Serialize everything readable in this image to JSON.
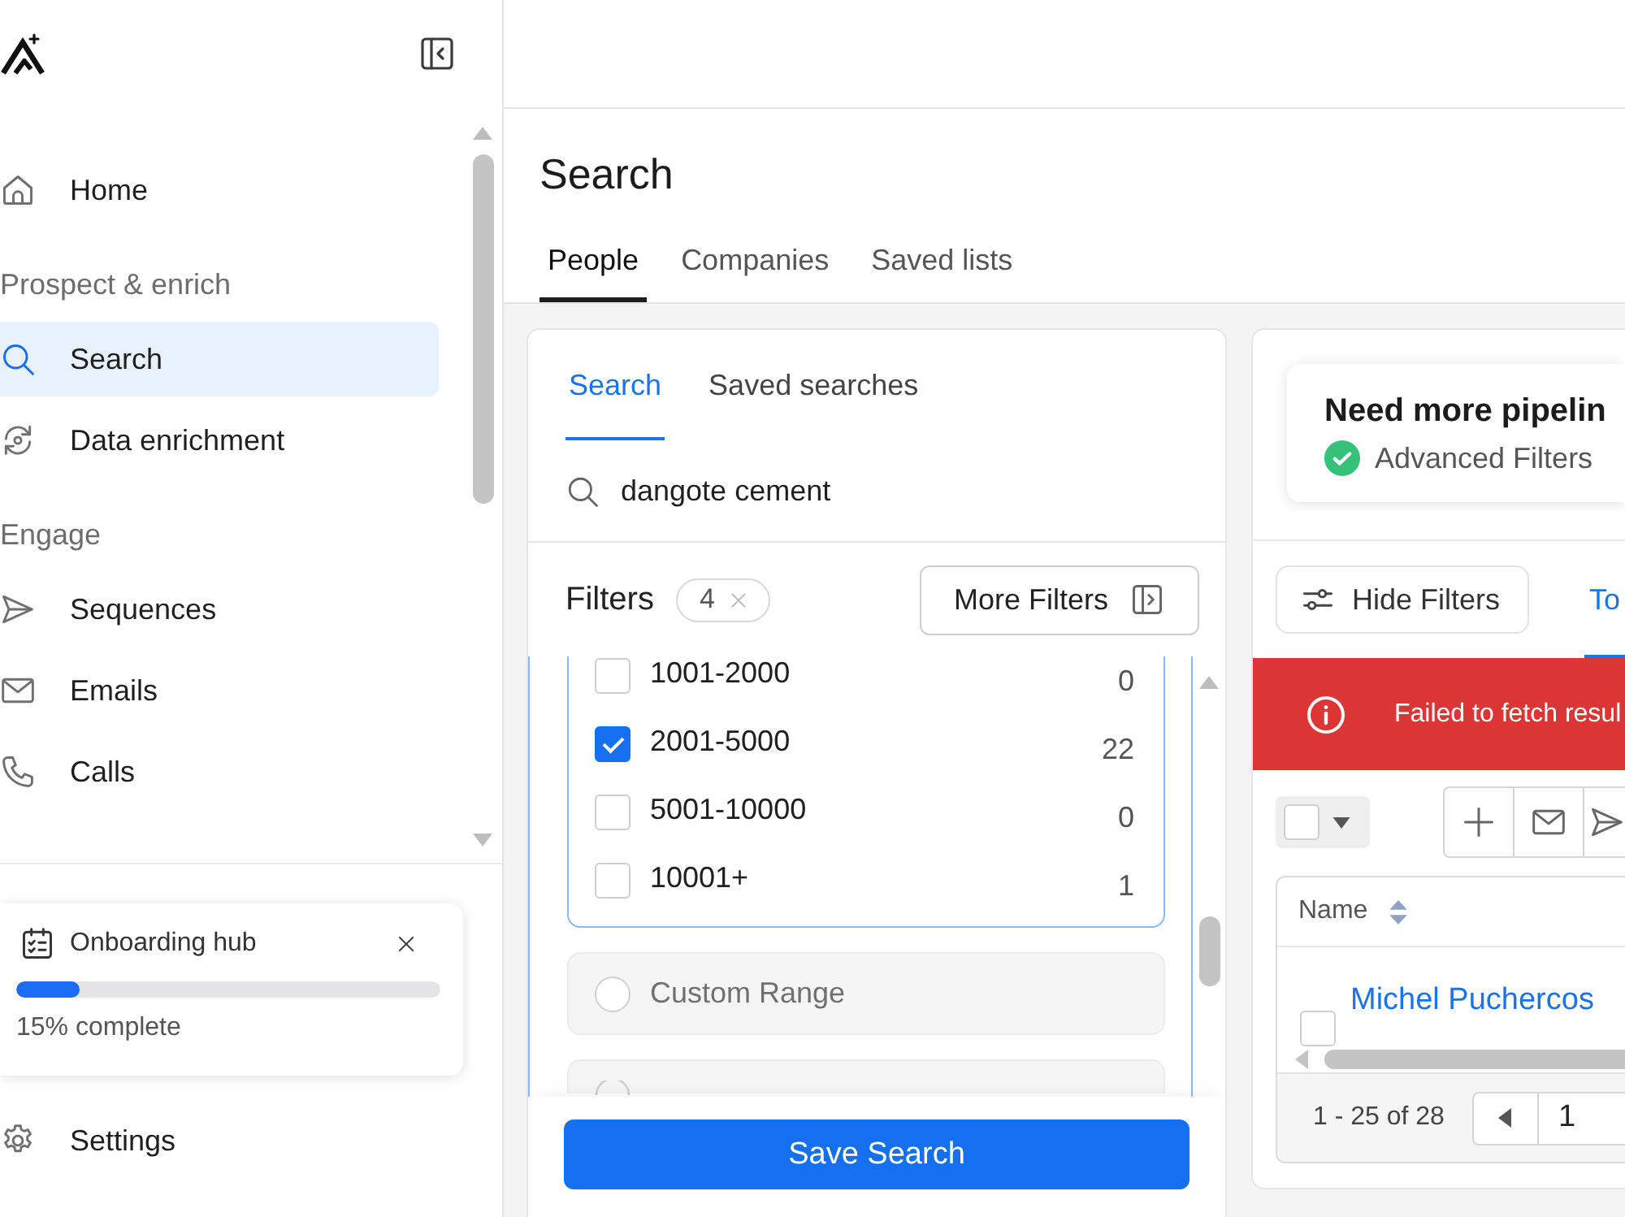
{
  "sidebar": {
    "sections": [
      {
        "items": [
          {
            "label": "Home",
            "selected": false
          }
        ]
      },
      {
        "heading": "Prospect & enrich",
        "items": [
          {
            "label": "Search",
            "selected": true
          },
          {
            "label": "Data enrichment",
            "selected": false
          }
        ]
      },
      {
        "heading": "Engage",
        "items": [
          {
            "label": "Sequences",
            "selected": false
          },
          {
            "label": "Emails",
            "selected": false
          },
          {
            "label": "Calls",
            "selected": false
          }
        ]
      }
    ],
    "onboarding": {
      "title": "Onboarding hub",
      "level": 0.15,
      "progress": "15% complete"
    },
    "bottom_items": [
      {
        "label": "Settings"
      }
    ]
  },
  "page": {
    "title": "Search",
    "tabs": [
      {
        "label": "People",
        "selected": true
      },
      {
        "label": "Companies",
        "selected": false
      },
      {
        "label": "Saved lists",
        "selected": false
      }
    ]
  },
  "search_panel": {
    "tabs": [
      {
        "label": "Search",
        "selected": true
      },
      {
        "label": "Saved searches",
        "selected": false
      }
    ],
    "search": {
      "value": "dangote cement"
    },
    "filters": {
      "title": "Filters",
      "count": "4",
      "more_button": "More Filters"
    },
    "size_options": [
      {
        "label": "1001-2000",
        "count": "0",
        "checked": false
      },
      {
        "label": "2001-5000",
        "count": "22",
        "checked": true
      },
      {
        "label": "5001-10000",
        "count": "0",
        "checked": false
      },
      {
        "label": "10001+",
        "count": "1",
        "checked": false
      }
    ],
    "range_options": [
      {
        "label": "Custom Range",
        "selected": false
      },
      {
        "selected": false
      }
    ],
    "save_button": "Save Search"
  },
  "results_panel": {
    "promo": {
      "title": "Need more pipelin",
      "feature": "Advanced Filters"
    },
    "hide_filters_button": "Hide Filters",
    "tabs": [
      {
        "label": "To",
        "selected": true
      }
    ],
    "error": "Failed to fetch resul",
    "select_all": {
      "checked": false
    },
    "table": {
      "columns": [
        {
          "label": "Name"
        }
      ],
      "rows": [
        {
          "name": "Michel Puchercos",
          "checked": false
        }
      ]
    },
    "pagination": {
      "range": "1 - 25 of 28",
      "page": "1"
    }
  }
}
